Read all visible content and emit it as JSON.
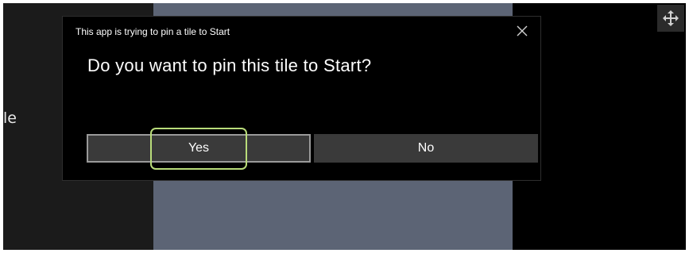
{
  "background": {
    "partial_left_text": "le"
  },
  "dialog": {
    "title": "This app is trying to pin a tile to Start",
    "question": "Do you want to pin this tile to Start?",
    "buttons": {
      "yes_label": "Yes",
      "no_label": "No"
    }
  },
  "icons": {
    "close": "close-icon",
    "move": "move-arrows-icon"
  },
  "colors": {
    "dialog_bg": "#000000",
    "tile_bg": "#5c6475",
    "button_bg": "#3a3a3a",
    "highlight": "#b9dc7a"
  }
}
